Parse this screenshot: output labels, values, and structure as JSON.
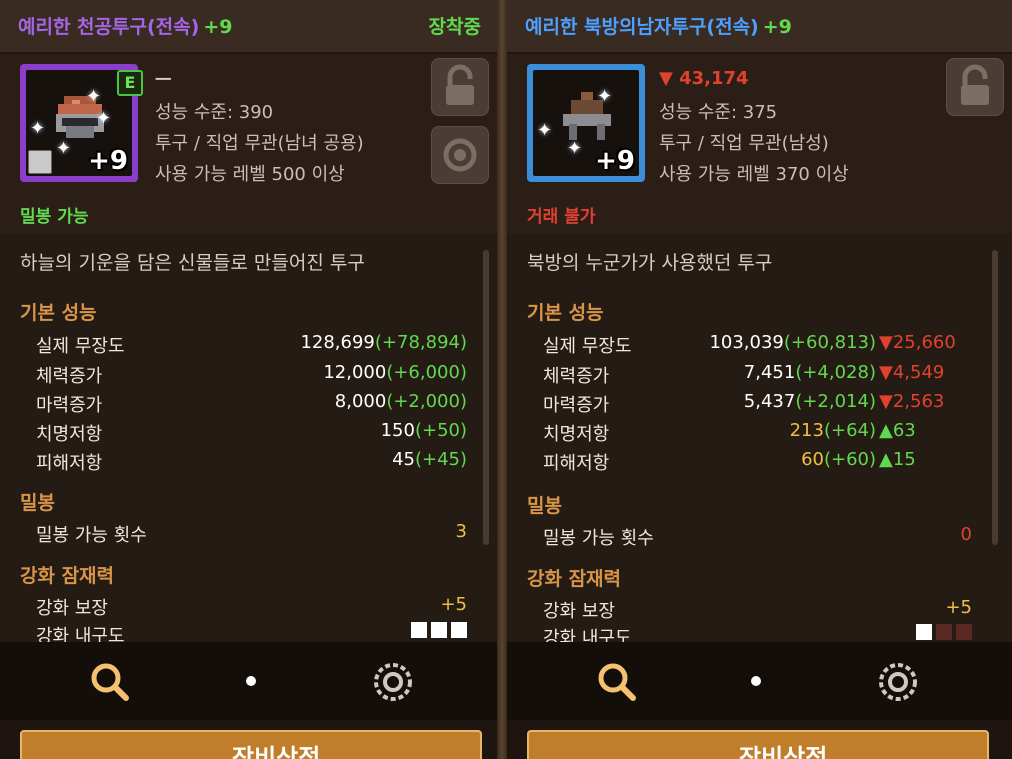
{
  "left": {
    "header": {
      "name": "예리한 천공투구(전속)",
      "plus": "+9",
      "status": "장착중"
    },
    "item": {
      "badge": "E",
      "compare_text": "ㅡ",
      "power_label": "성능 수준: 390",
      "type_label": "투구 / 직업 무관(남녀 공용)",
      "level_label": "사용 가능 레벨 500 이상",
      "enhance_level": "+9",
      "frame_color": "#8a3ec9",
      "trade_status": "밀봉 가능",
      "trade_color": "#62d84e"
    },
    "description": "하늘의 기운을 담은 신물들로 만들어진 투구",
    "basic": {
      "title": "기본 성능",
      "rows": [
        {
          "label": "실제 무장도",
          "value": "128,699",
          "bonus": "(+78,894)"
        },
        {
          "label": "체력증가",
          "value": "12,000",
          "bonus": "(+6,000)"
        },
        {
          "label": "마력증가",
          "value": "8,000",
          "bonus": "(+2,000)"
        },
        {
          "label": "치명저항",
          "value": "150",
          "bonus": "(+50)"
        },
        {
          "label": "피해저항",
          "value": "45",
          "bonus": "(+45)"
        }
      ]
    },
    "seal": {
      "title": "밀봉",
      "label": "밀봉 가능 횟수",
      "value": "3"
    },
    "enhance": {
      "title": "강화 잠재력",
      "guarantee_label": "강화 보장",
      "guarantee_value": "+5",
      "durability_label": "강화 내구도",
      "durability_filled": 3,
      "durability_total": 3
    },
    "bottom_button": "장비상점"
  },
  "right": {
    "header": {
      "name": "예리한 북방의남자투구(전속)",
      "plus": "+9"
    },
    "item": {
      "compare_text": "▼ 43,174",
      "power_label": "성능 수준: 375",
      "type_label": "투구 / 직업 무관(남성)",
      "level_label": "사용 가능 레벨 370 이상",
      "enhance_level": "+9",
      "frame_color": "#3d8ed8",
      "trade_status": "거래 불가",
      "trade_color": "#e0422e"
    },
    "description": "북방의 누군가가 사용했던 투구",
    "basic": {
      "title": "기본 성능",
      "rows": [
        {
          "label": "실제 무장도",
          "value": "103,039",
          "bonus": "(+60,813)",
          "diff": "▼25,660",
          "diff_color": "#e0422e",
          "value_color": "#ffffff"
        },
        {
          "label": "체력증가",
          "value": "7,451",
          "bonus": "(+4,028)",
          "diff": "▼4,549",
          "diff_color": "#e0422e",
          "value_color": "#ffffff"
        },
        {
          "label": "마력증가",
          "value": "5,437",
          "bonus": "(+2,014)",
          "diff": "▼2,563",
          "diff_color": "#e0422e",
          "value_color": "#ffffff"
        },
        {
          "label": "치명저항",
          "value": "213",
          "bonus": "(+64)",
          "diff": "▲63",
          "diff_color": "#62d84e",
          "value_color": "#f0c040"
        },
        {
          "label": "피해저항",
          "value": "60",
          "bonus": "(+60)",
          "diff": "▲15",
          "diff_color": "#62d84e",
          "value_color": "#f0c040"
        }
      ]
    },
    "seal": {
      "title": "밀봉",
      "label": "밀봉 가능 횟수",
      "value": "0"
    },
    "enhance": {
      "title": "강화 잠재력",
      "guarantee_label": "강화 보장",
      "guarantee_value": "+5",
      "durability_label": "강화 내구도",
      "durability_filled": 1,
      "durability_total": 3
    },
    "bottom_button": "장비상점"
  }
}
